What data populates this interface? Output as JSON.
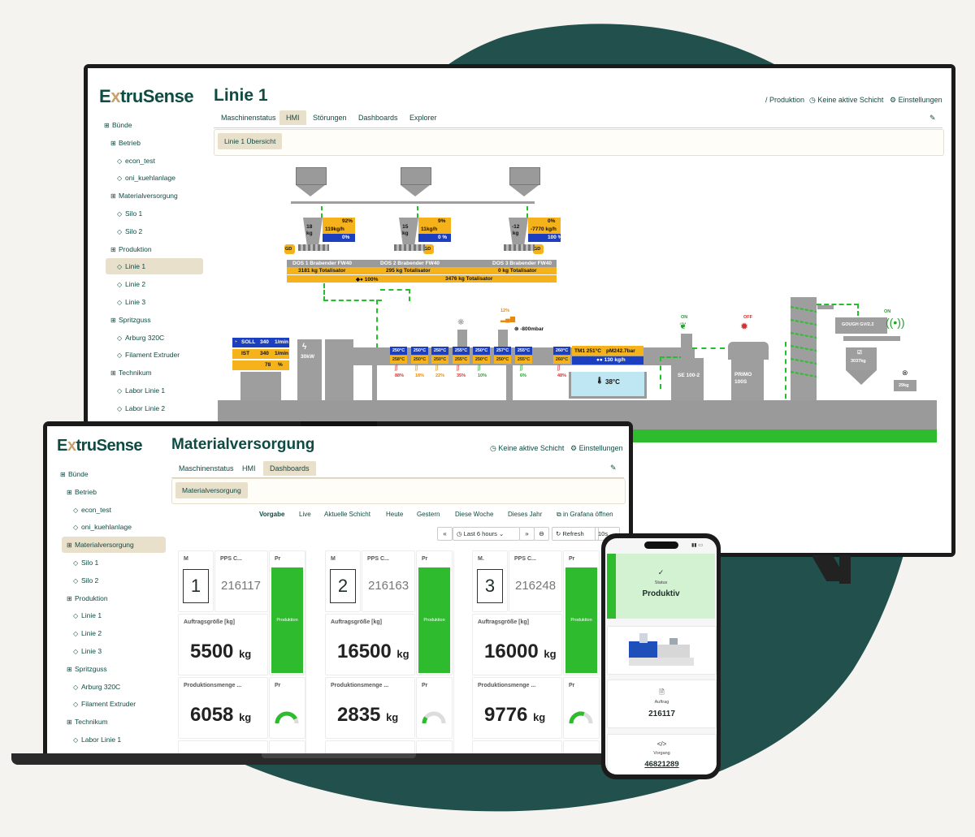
{
  "brand": {
    "name_pre": "E",
    "name_x": "x",
    "name_post": "truSense"
  },
  "tv": {
    "page_title": "Linie 1",
    "top_links": {
      "production": "/ Produktion",
      "shift": "Keine aktive Schicht",
      "settings": "Einstellungen"
    },
    "tabs": [
      "Maschinenstatus",
      "HMI",
      "Störungen",
      "Dashboards",
      "Explorer"
    ],
    "active_tab": "HMI",
    "sub_chip": "Linie 1 Übersicht",
    "sidebar": [
      {
        "label": "Bünde",
        "level": 0
      },
      {
        "label": "Betrieb",
        "level": 1
      },
      {
        "label": "econ_test",
        "level": 2
      },
      {
        "label": "oni_kuehlanlage",
        "level": 2
      },
      {
        "label": "Materialversorgung",
        "level": 1
      },
      {
        "label": "Silo 1",
        "level": 2
      },
      {
        "label": "Silo 2",
        "level": 2
      },
      {
        "label": "Produktion",
        "level": 1
      },
      {
        "label": "Linie 1",
        "level": 2,
        "active": true
      },
      {
        "label": "Linie 2",
        "level": 2
      },
      {
        "label": "Linie 3",
        "level": 2
      },
      {
        "label": "Spritzguss",
        "level": 1
      },
      {
        "label": "Arburg 320C",
        "level": 2
      },
      {
        "label": "Filament Extruder",
        "level": 2
      },
      {
        "label": "Technikum",
        "level": 1
      },
      {
        "label": "Labor Linie 1",
        "level": 2
      },
      {
        "label": "Labor Linie 2",
        "level": 2
      }
    ],
    "hmi": {
      "dosers": [
        {
          "weight": "18\nkg",
          "pct": "92%",
          "rate": "119kg/h",
          "blue": "0%",
          "gd": "GD",
          "name": "DOS 1 Brabender FW40",
          "total": "3181 kg Totalisator"
        },
        {
          "weight": "15\nkg",
          "pct": "9%",
          "rate": "11kg/h",
          "blue": "0 %",
          "gd": "GD",
          "name": "DOS 2 Brabender FW40",
          "total": "295 kg Totalisator"
        },
        {
          "weight": "-12\nkg",
          "pct": "0%",
          "rate": "-7770 kg/h",
          "blue": "100 %",
          "gd": "GD",
          "name": "DOS 3 Brabender FW40",
          "total": "0 kg Totalisator"
        }
      ],
      "sum_bar": {
        "pct": "100%",
        "total": "3476 kg Totalisator"
      },
      "motor": {
        "soll_label": "SOLL",
        "soll_val": "340",
        "soll_unit": "1/min",
        "ist_label": "IST",
        "ist_val": "340",
        "ist_unit": "1/min",
        "load": "78",
        "load_unit": "%",
        "power": "30kW"
      },
      "zones_top": [
        "250°C",
        "250°C",
        "250°C",
        "255°C",
        "250°C",
        "257°C",
        "255°C",
        "260°C"
      ],
      "zones_bot": [
        "258°C",
        "250°C",
        "250°C",
        "255°C",
        "250°C",
        "250°C",
        "255°C",
        "260°C"
      ],
      "zone_pcts": [
        "88%",
        "18%",
        "22%",
        "35%",
        "10%",
        "6%",
        "48%"
      ],
      "vacuum": "-800mbar",
      "vent_pct": "12%",
      "melt": {
        "tm": "TM1 251°C",
        "pm": "pM242.7bar",
        "rate": "130 kg/h"
      },
      "bath": "38°C",
      "se": "SE 100-2",
      "primo": "PRIMO\n100S",
      "status_on1": "ON",
      "status_off": "OFF",
      "status_on2": "ON",
      "gough": "GOUGH GV/2.2",
      "bin_weight": "3037kg",
      "scrap_weight": "29kg"
    }
  },
  "laptop": {
    "page_title": "Materialversorgung",
    "top_links": {
      "shift": "Keine aktive Schicht",
      "settings": "Einstellungen"
    },
    "tabs": [
      "Maschinenstatus",
      "HMI",
      "Dashboards"
    ],
    "active_tab": "Dashboards",
    "sub_chip": "Materialversorgung",
    "time_tabs": [
      "Vorgabe",
      "Live",
      "Aktuelle Schicht",
      "Heute",
      "Gestern",
      "Diese Woche",
      "Dieses Jahr",
      "in Grafana öffnen"
    ],
    "time_picker": "Last 6 hours",
    "refresh": "Refresh",
    "refresh_interval": "10s",
    "sidebar": [
      {
        "label": "Bünde",
        "level": 0
      },
      {
        "label": "Betrieb",
        "level": 1
      },
      {
        "label": "econ_test",
        "level": 2
      },
      {
        "label": "oni_kuehlanlage",
        "level": 2
      },
      {
        "label": "Materialversorgung",
        "level": 1,
        "active": true
      },
      {
        "label": "Silo 1",
        "level": 2
      },
      {
        "label": "Silo 2",
        "level": 2
      },
      {
        "label": "Produktion",
        "level": 1
      },
      {
        "label": "Linie 1",
        "level": 2
      },
      {
        "label": "Linie 2",
        "level": 2
      },
      {
        "label": "Linie 3",
        "level": 2
      },
      {
        "label": "Spritzguss",
        "level": 1
      },
      {
        "label": "Arburg 320C",
        "level": 2
      },
      {
        "label": "Filament Extruder",
        "level": 2
      },
      {
        "label": "Technikum",
        "level": 1
      },
      {
        "label": "Labor Linie 1",
        "level": 2
      }
    ],
    "columns": [
      {
        "m_label": "M",
        "m_val": "1",
        "pps_label": "PPS C...",
        "pps_val": "216117",
        "pr_label": "Pr",
        "status": "Produktion",
        "order_label": "Auftragsgröße [kg]",
        "order_val": "5500",
        "unit": "kg",
        "prod_label": "Produktionsmenge ...",
        "prod_val": "6058",
        "gauge_label": "Pr",
        "gauge_frac": 0.85
      },
      {
        "m_label": "M",
        "m_val": "2",
        "pps_label": "PPS C...",
        "pps_val": "216163",
        "pr_label": "Pr",
        "status": "Produktion",
        "order_label": "Auftragsgröße [kg]",
        "order_val": "16500",
        "unit": "kg",
        "prod_label": "Produktionsmenge ...",
        "prod_val": "2835",
        "gauge_label": "Pr",
        "gauge_frac": 0.2
      },
      {
        "m_label": "M.",
        "m_val": "3",
        "pps_label": "PPS C...",
        "pps_val": "216248",
        "pr_label": "Pr",
        "status": "Produktion",
        "order_label": "Auftragsgröße [kg]",
        "order_val": "16000",
        "unit": "kg",
        "prod_label": "Produktionsmenge ...",
        "prod_val": "9776",
        "gauge_label": "Pr",
        "gauge_frac": 0.6
      }
    ]
  },
  "phone": {
    "status_label": "Status",
    "status_val": "Produktiv",
    "order_label": "Auftrag",
    "order_val": "216117",
    "process_label": "Vorgang",
    "process_val": "46821289"
  },
  "colors": {
    "brand": "#0e4b43",
    "accent": "#c8a26d",
    "active_bg": "#e9e0cc",
    "green": "#2ebc2e",
    "blob": "#22504c"
  }
}
